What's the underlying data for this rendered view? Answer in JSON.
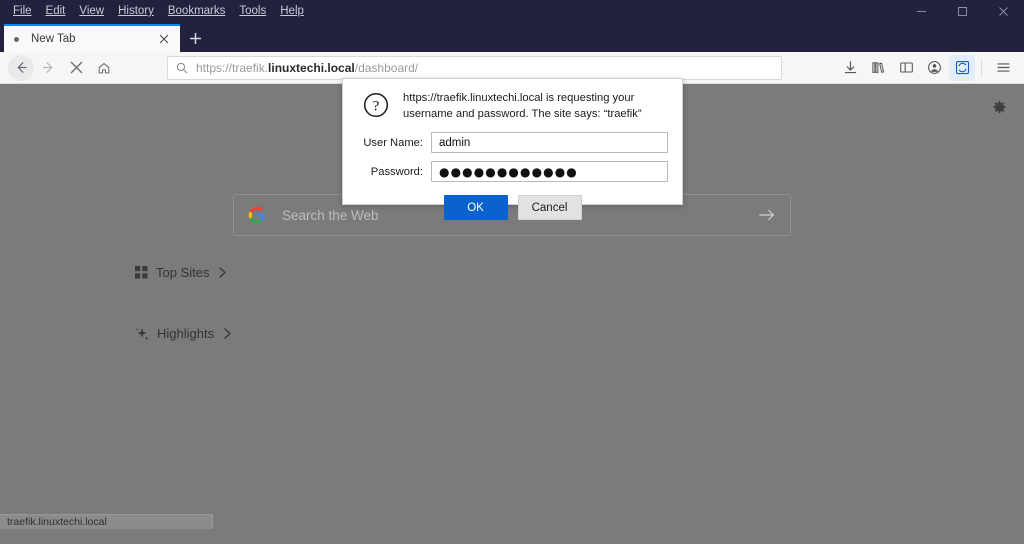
{
  "titlebar": {
    "menus": [
      {
        "label": "File",
        "accel": "F"
      },
      {
        "label": "Edit",
        "accel": "E"
      },
      {
        "label": "View",
        "accel": "V"
      },
      {
        "label": "History",
        "accel": "s"
      },
      {
        "label": "Bookmarks",
        "accel": "B"
      },
      {
        "label": "Tools",
        "accel": "T"
      },
      {
        "label": "Help",
        "accel": "H"
      }
    ],
    "window_controls": {
      "minimize": "minimize-icon",
      "maximize": "maximize-icon",
      "close": "close-icon"
    }
  },
  "tabs": {
    "items": [
      {
        "title": "New Tab",
        "favicon": "dot-favicon",
        "close_label": "close-tab-icon"
      }
    ],
    "new_tab_label": "+"
  },
  "navbar": {
    "back_icon": "back-arrow-icon",
    "forward_icon": "forward-arrow-icon",
    "stop_icon": "stop-x-icon",
    "home_icon": "home-icon",
    "url": {
      "search_icon": "search-icon",
      "prefix": "https://traefik.",
      "domain": "linuxtechi.local",
      "suffix": "/dashboard/",
      "full": "https://traefik.linuxtechi.local/dashboard/"
    },
    "toolbar_icons": [
      {
        "name": "downloads-icon",
        "active": false
      },
      {
        "name": "library-icon",
        "active": false
      },
      {
        "name": "sidebar-icon",
        "active": false
      },
      {
        "name": "account-icon",
        "active": false
      },
      {
        "name": "sync-pocket-icon",
        "active": true
      },
      {
        "name": "hamburger-menu-icon",
        "active": false
      }
    ]
  },
  "newtab": {
    "gear_icon": "gear-icon",
    "search": {
      "placeholder": "Search the Web",
      "engine_icon": "google-g-icon",
      "submit_icon": "arrow-right-icon"
    },
    "sections": [
      {
        "label": "Top Sites",
        "icon": "grid-squares-icon",
        "chevron": "chevron-right-icon"
      },
      {
        "label": "Highlights",
        "icon": "sparkle-icon",
        "chevron": "chevron-right-icon"
      }
    ]
  },
  "statusbar": {
    "text": "traefik.linuxtechi.local"
  },
  "auth_dialog": {
    "icon": "question-mark-icon",
    "message": "https://traefik.linuxtechi.local is requesting your username and password. The site says: “traefik”",
    "fields": [
      {
        "label": "User Name:",
        "value": "admin",
        "type": "text"
      },
      {
        "label": "Password:",
        "value": "●●●●●●●●●●●●",
        "type": "password"
      }
    ],
    "buttons": {
      "ok": "OK",
      "cancel": "Cancel"
    }
  },
  "colors": {
    "chrome_dark": "#22223f",
    "tab_active_border": "#0a84ff",
    "toolbar_bg": "#f6f6f7",
    "dimmed_overlay": "#7b7b7b",
    "primary_button": "#0a62ce",
    "secondary_button": "#e2e2e4"
  }
}
